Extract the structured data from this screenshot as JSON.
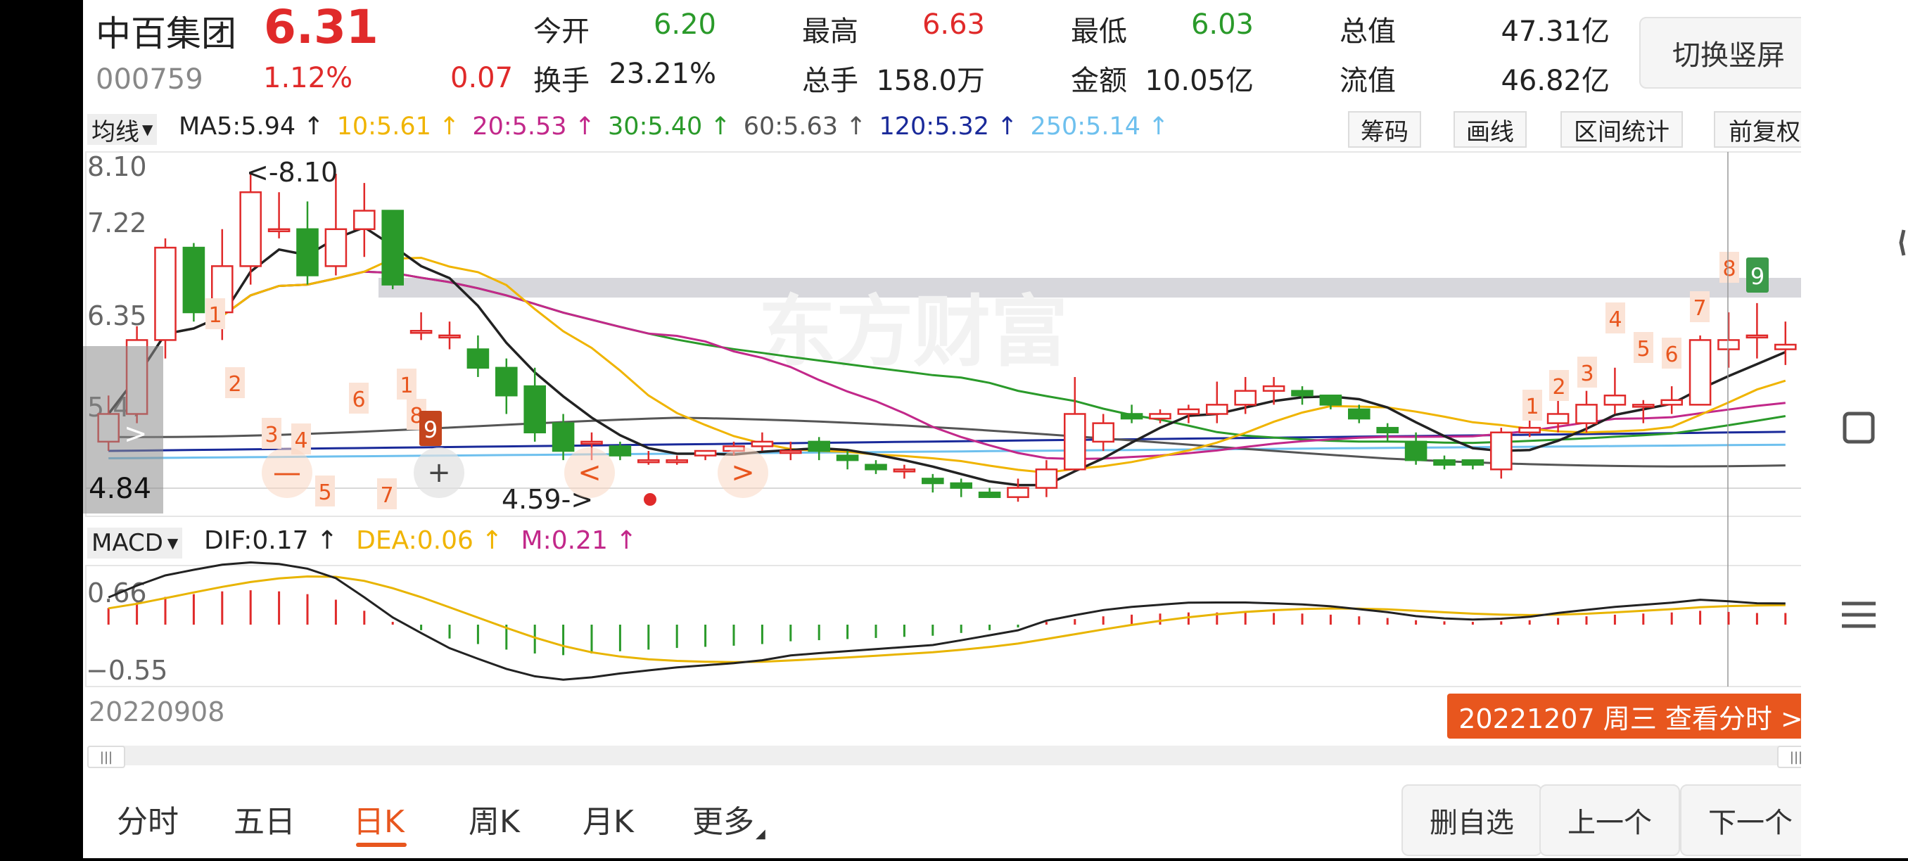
{
  "header": {
    "name": "中百集团",
    "price": "6.31",
    "code": "000759",
    "pct": "1.12%",
    "change": "0.07",
    "stats": [
      {
        "label": "今开",
        "value": "6.20",
        "color": "green"
      },
      {
        "label": "最高",
        "value": "6.63",
        "color": "red"
      },
      {
        "label": "最低",
        "value": "6.03",
        "color": "green"
      },
      {
        "label": "总值",
        "value": "47.31亿",
        "color": "dark"
      },
      {
        "label": "换手",
        "value": "23.21%",
        "color": "dark"
      },
      {
        "label": "总手",
        "value": "158.0万",
        "color": "dark"
      },
      {
        "label": "金额",
        "value": "10.05亿",
        "color": "dark"
      },
      {
        "label": "流值",
        "value": "46.82亿",
        "color": "dark"
      }
    ],
    "switch_label": "切换竖屏"
  },
  "ma_bar": {
    "selector": "均线",
    "items": [
      {
        "text": "MA5:5.94 ↑",
        "color": "#222222"
      },
      {
        "text": "10:5.61 ↑",
        "color": "#f0b400"
      },
      {
        "text": "20:5.53 ↑",
        "color": "#c2288a"
      },
      {
        "text": "30:5.40 ↑",
        "color": "#2a9a2a"
      },
      {
        "text": "60:5.63 ↑",
        "color": "#555555"
      },
      {
        "text": "120:5.32 ↑",
        "color": "#1a2a9a"
      },
      {
        "text": "250:5.14 ↑",
        "color": "#6ec0ee"
      }
    ],
    "buttons": [
      "筹码",
      "画线",
      "区间统计",
      "前复权"
    ]
  },
  "kline": {
    "y_ticks": [
      "8.10",
      "7.22",
      "6.35",
      "5.47"
    ],
    "low_label": "4.84",
    "max_annotation": "<-8.10",
    "min_annotation": "4.59->",
    "watermark": "东方财富"
  },
  "macd_bar": {
    "selector": "MACD",
    "items": [
      {
        "text": "DIF:0.17 ↑",
        "color": "#222222"
      },
      {
        "text": "DEA:0.06 ↑",
        "color": "#f0b400"
      },
      {
        "text": "M:0.21 ↑",
        "color": "#c2288a"
      }
    ]
  },
  "macd": {
    "top_label": "0.66",
    "bottom_label": "−0.55"
  },
  "footer": {
    "start_date": "20220908",
    "selected_date": "20221207 周三 查看分时 >"
  },
  "tabs": [
    {
      "label": "分时",
      "active": false
    },
    {
      "label": "五日",
      "active": false
    },
    {
      "label": "日K",
      "active": true
    },
    {
      "label": "周K",
      "active": false
    },
    {
      "label": "月K",
      "active": false
    },
    {
      "label": "更多",
      "active": false
    }
  ],
  "actions": [
    "删自选",
    "上一个",
    "下一个"
  ],
  "colors": {
    "up": "#e02a2a",
    "down": "#2a9a2a",
    "accent": "#e8561e",
    "highlight": "#d7d7dc"
  },
  "chart_data": {
    "type": "candlestick",
    "x_start": "20220908",
    "x_end": "20221207",
    "y_range": [
      4.59,
      8.1
    ],
    "last_close": 6.31,
    "candles": [
      [
        5.2,
        5.5,
        5.7,
        5.1
      ],
      [
        5.5,
        6.3,
        6.45,
        5.4
      ],
      [
        6.3,
        7.3,
        7.4,
        6.1
      ],
      [
        7.3,
        6.6,
        7.35,
        6.5
      ],
      [
        6.6,
        7.1,
        7.5,
        6.3
      ],
      [
        7.1,
        7.9,
        8.1,
        6.9
      ],
      [
        7.5,
        7.5,
        7.9,
        7.4
      ],
      [
        7.5,
        7.0,
        7.8,
        6.9
      ],
      [
        7.1,
        7.5,
        8.1,
        7.0
      ],
      [
        7.5,
        7.7,
        8.0,
        7.2
      ],
      [
        7.7,
        6.9,
        7.6,
        6.85
      ],
      [
        6.4,
        6.4,
        6.6,
        6.3
      ],
      [
        6.35,
        6.35,
        6.5,
        6.2
      ],
      [
        6.2,
        6.0,
        6.35,
        5.9
      ],
      [
        6.0,
        5.7,
        6.1,
        5.5
      ],
      [
        5.8,
        5.3,
        6.0,
        5.2
      ],
      [
        5.4,
        5.1,
        5.5,
        5.0
      ],
      [
        5.2,
        5.2,
        5.3,
        5.0
      ],
      [
        5.15,
        5.05,
        5.2,
        5.0
      ],
      [
        5.0,
        5.0,
        5.1,
        4.95
      ],
      [
        5.0,
        5.0,
        5.05,
        4.95
      ],
      [
        5.05,
        5.1,
        5.1,
        5.0
      ],
      [
        5.1,
        5.15,
        5.2,
        5.05
      ],
      [
        5.15,
        5.2,
        5.3,
        5.1
      ],
      [
        5.1,
        5.1,
        5.2,
        5.0
      ],
      [
        5.2,
        5.1,
        5.25,
        5.0
      ],
      [
        5.05,
        5.0,
        5.1,
        4.9
      ],
      [
        4.95,
        4.9,
        5.0,
        4.85
      ],
      [
        4.9,
        4.9,
        4.95,
        4.8
      ],
      [
        4.8,
        4.75,
        4.85,
        4.65
      ],
      [
        4.75,
        4.7,
        4.8,
        4.6
      ],
      [
        4.65,
        4.6,
        4.7,
        4.59
      ],
      [
        4.6,
        4.7,
        4.8,
        4.55
      ],
      [
        4.7,
        4.9,
        5.0,
        4.6
      ],
      [
        4.9,
        5.5,
        5.9,
        4.9
      ],
      [
        5.2,
        5.4,
        5.5,
        5.1
      ],
      [
        5.5,
        5.45,
        5.6,
        5.4
      ],
      [
        5.45,
        5.5,
        5.55,
        5.4
      ],
      [
        5.5,
        5.55,
        5.6,
        5.4
      ],
      [
        5.5,
        5.6,
        5.85,
        5.4
      ],
      [
        5.6,
        5.75,
        5.9,
        5.5
      ],
      [
        5.75,
        5.8,
        5.9,
        5.6
      ],
      [
        5.75,
        5.7,
        5.8,
        5.6
      ],
      [
        5.7,
        5.6,
        5.7,
        5.55
      ],
      [
        5.55,
        5.45,
        5.6,
        5.4
      ],
      [
        5.35,
        5.3,
        5.4,
        5.2
      ],
      [
        5.2,
        5.0,
        5.3,
        4.95
      ],
      [
        5.0,
        4.95,
        5.05,
        4.9
      ],
      [
        5.0,
        4.95,
        5.0,
        4.9
      ],
      [
        4.9,
        5.3,
        5.35,
        4.8
      ],
      [
        5.3,
        5.35,
        5.5,
        5.25
      ],
      [
        5.4,
        5.5,
        5.65,
        5.3
      ],
      [
        5.4,
        5.6,
        5.75,
        5.3
      ],
      [
        5.6,
        5.7,
        6.0,
        5.5
      ],
      [
        5.6,
        5.6,
        5.65,
        5.4
      ],
      [
        5.6,
        5.65,
        5.8,
        5.5
      ],
      [
        5.6,
        6.3,
        6.35,
        5.6
      ],
      [
        6.2,
        6.3,
        6.6,
        6.0
      ],
      [
        6.35,
        6.35,
        6.7,
        6.1
      ],
      [
        6.2,
        6.25,
        6.5,
        6.03
      ]
    ],
    "macd_hist": [
      0.3,
      0.4,
      0.5,
      0.55,
      0.6,
      0.62,
      0.6,
      0.55,
      0.45,
      0.25,
      0.05,
      -0.1,
      -0.25,
      -0.35,
      -0.45,
      -0.52,
      -0.55,
      -0.52,
      -0.48,
      -0.45,
      -0.42,
      -0.4,
      -0.38,
      -0.35,
      -0.3,
      -0.28,
      -0.26,
      -0.24,
      -0.22,
      -0.2,
      -0.15,
      -0.1,
      -0.05,
      0.05,
      0.1,
      0.15,
      0.18,
      0.2,
      0.22,
      0.22,
      0.22,
      0.21,
      0.2,
      0.18,
      0.15,
      0.12,
      0.08,
      0.06,
      0.05,
      0.06,
      0.08,
      0.12,
      0.15,
      0.18,
      0.2,
      0.22,
      0.25,
      0.23,
      0.21,
      0.21
    ],
    "dif_label": "DIF:0.17",
    "dea_label": "DEA:0.06",
    "m_label": "M:0.21",
    "series_colors": {
      "MA5": "#222222",
      "MA10": "#f0b400",
      "MA20": "#c2288a",
      "MA30": "#2a9a2a",
      "MA60": "#555555",
      "MA120": "#1a2a9a",
      "MA250": "#6ec0ee"
    }
  }
}
